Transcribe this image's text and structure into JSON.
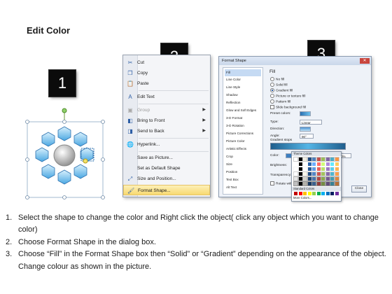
{
  "title": "Edit Color",
  "badges": [
    "1",
    "2",
    "3"
  ],
  "context_menu": {
    "items": [
      {
        "label": "Cut",
        "icon": "scissors-icon",
        "glyph": "✂",
        "disabled": false,
        "submenu": false
      },
      {
        "label": "Copy",
        "icon": "copy-icon",
        "glyph": "❐",
        "disabled": false,
        "submenu": false
      },
      {
        "label": "Paste",
        "icon": "paste-icon",
        "glyph": "📋",
        "disabled": false,
        "submenu": false
      },
      {
        "label": "Edit Text",
        "icon": "edit-text-icon",
        "glyph": "A",
        "disabled": false,
        "submenu": false
      },
      {
        "label": "Group",
        "icon": "group-icon",
        "glyph": "▣",
        "disabled": true,
        "submenu": true
      },
      {
        "label": "Bring to Front",
        "icon": "bring-front-icon",
        "glyph": "◧",
        "disabled": false,
        "submenu": true
      },
      {
        "label": "Send to Back",
        "icon": "send-back-icon",
        "glyph": "◨",
        "disabled": false,
        "submenu": true
      },
      {
        "label": "Hyperlink...",
        "icon": "hyperlink-icon",
        "glyph": "🌐",
        "disabled": false,
        "submenu": false
      },
      {
        "label": "Save as Picture...",
        "icon": "",
        "glyph": "",
        "disabled": false,
        "submenu": false
      },
      {
        "label": "Set as Default Shape",
        "icon": "",
        "glyph": "",
        "disabled": false,
        "submenu": false
      },
      {
        "label": "Size and Position...",
        "icon": "size-position-icon",
        "glyph": "⤢",
        "disabled": false,
        "submenu": false
      },
      {
        "label": "Format Shape...",
        "icon": "format-shape-icon",
        "glyph": "🖌",
        "disabled": false,
        "submenu": false,
        "highlighted": true
      }
    ]
  },
  "format_dialog": {
    "title": "Format Shape",
    "close_glyph": "✕",
    "categories": [
      "Fill",
      "Line Color",
      "Line Style",
      "Shadow",
      "Reflection",
      "Glow and Soft Edges",
      "3-D Format",
      "3-D Rotation",
      "Picture Corrections",
      "Picture Color",
      "Artistic Effects",
      "Crop",
      "Size",
      "Position",
      "Text Box",
      "Alt Text"
    ],
    "selected_category": "Fill",
    "heading": "Fill",
    "fill_options": [
      {
        "label": "No fill",
        "type": "radio",
        "checked": false
      },
      {
        "label": "Solid fill",
        "type": "radio",
        "checked": false
      },
      {
        "label": "Gradient fill",
        "type": "radio",
        "checked": true
      },
      {
        "label": "Picture or texture fill",
        "type": "radio",
        "checked": false
      },
      {
        "label": "Pattern fill",
        "type": "radio",
        "checked": false
      },
      {
        "label": "Slide background fill",
        "type": "checkbox",
        "checked": false
      }
    ],
    "preset_label": "Preset colors:",
    "type_label": "Type:",
    "type_value": "Linear",
    "direction_label": "Direction:",
    "angle_label": "Angle:",
    "angle_value": "90°",
    "stops_label": "Gradient stops",
    "color_label": "Color:",
    "position_label": "Position:",
    "position_value": "0%",
    "brightness_label": "Brightness:",
    "transparency_label": "Transparency:",
    "rotate_label": "Rotate with shape",
    "close_label": "Close",
    "theme_colors_label": "Theme Colors",
    "standard_colors_label": "Standard Colors",
    "more_colors_label": "More Colors...",
    "accent_color": "#54b5e6"
  },
  "instructions": [
    {
      "num": "1.",
      "text": "Select the shape to change the color and Right click the object( click any object which you want to change color)"
    },
    {
      "num": "2.",
      "text": "Choose Format Shape in the dialog box."
    },
    {
      "num": "3.",
      "text": "Choose “Fill” in the Format Shape box then “Solid” or “Gradient” depending on the appearance of the object. Change colour as shown in the picture."
    }
  ]
}
